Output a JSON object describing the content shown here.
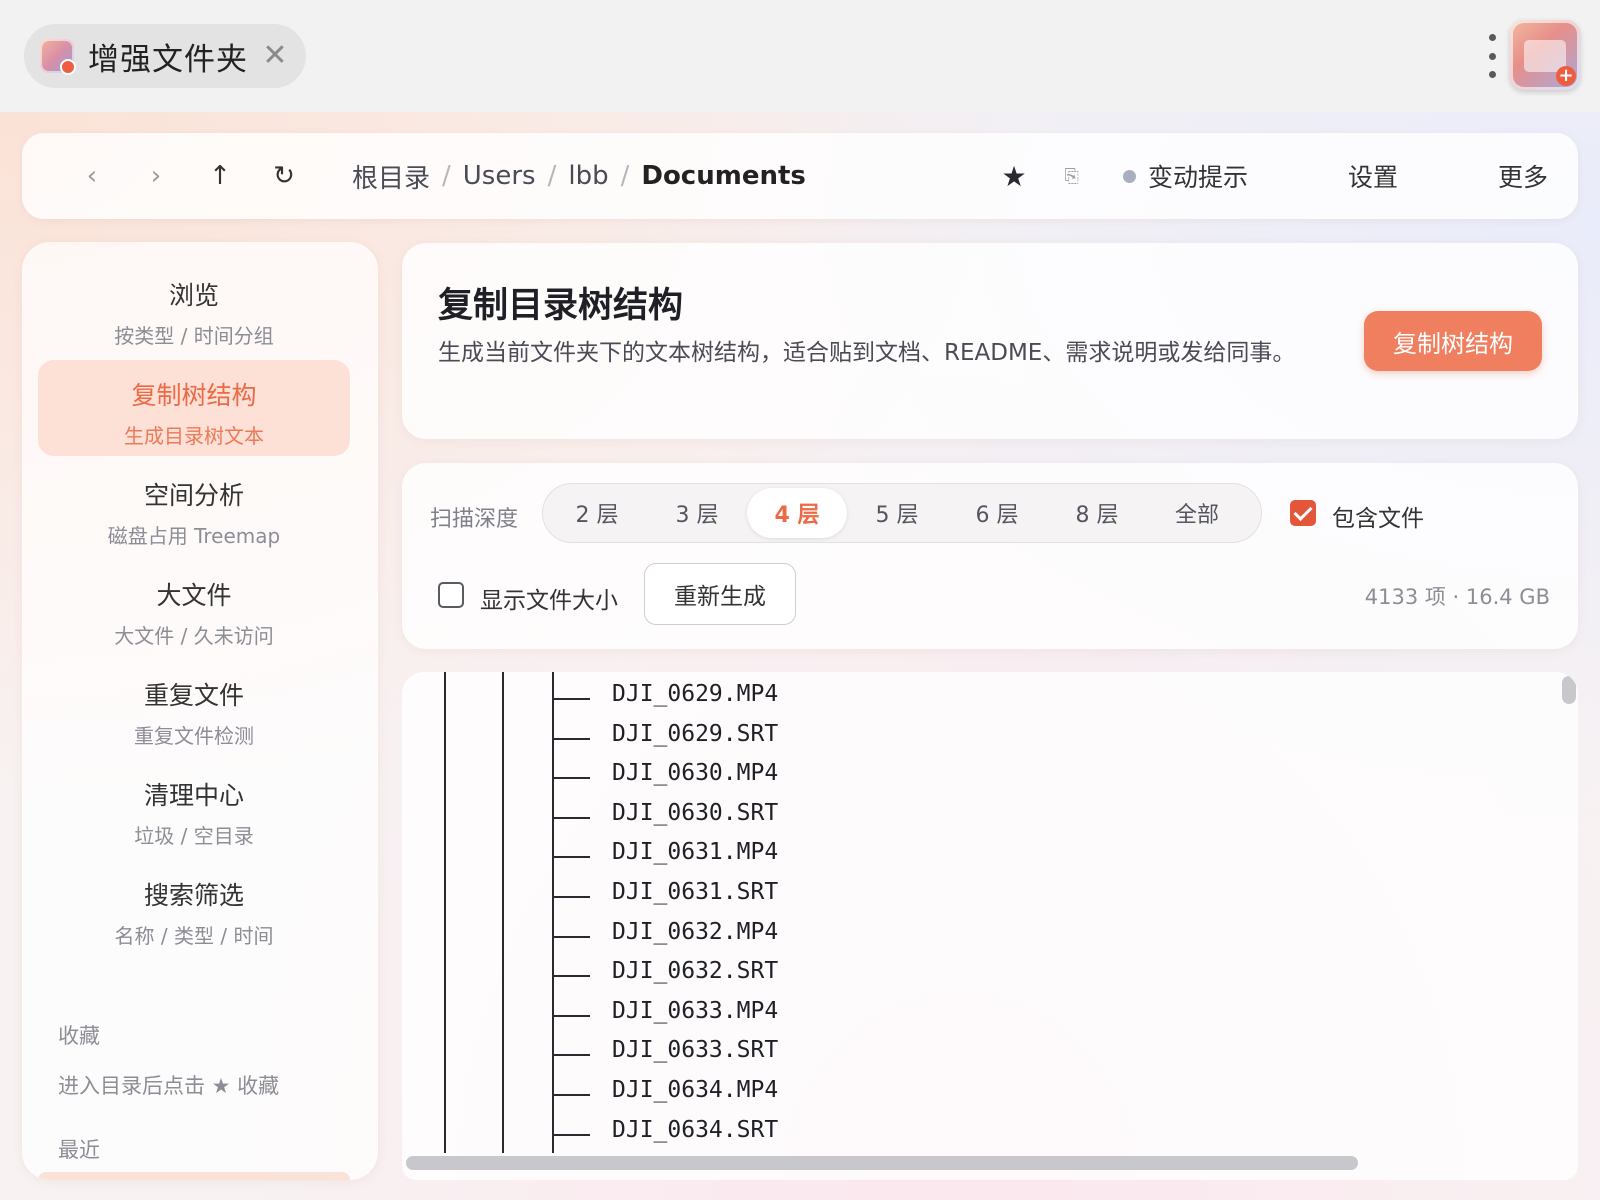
{
  "window": {
    "tab_title": "增强文件夹",
    "tab_icon": "app-folder-icon",
    "close_icon": "close-icon",
    "menu_icon": "kebab-menu-icon",
    "logo_icon": "app-logo-icon"
  },
  "nav": {
    "back": "‹",
    "forward": "›",
    "up": "↑",
    "refresh": "↻",
    "breadcrumbs": [
      "根目录",
      "Users",
      "lbb",
      "Documents"
    ],
    "separator": "/",
    "favorite": "★",
    "copy_path": "⎘",
    "change_notice": "变动提示",
    "settings": "设置",
    "more": "更多"
  },
  "sidebar": {
    "items": [
      {
        "title": "浏览",
        "subtitle": "按类型 / 时间分组",
        "active": false
      },
      {
        "title": "复制树结构",
        "subtitle": "生成目录树文本",
        "active": true
      },
      {
        "title": "空间分析",
        "subtitle": "磁盘占用 Treemap",
        "active": false
      },
      {
        "title": "大文件",
        "subtitle": "大文件 / 久未访问",
        "active": false
      },
      {
        "title": "重复文件",
        "subtitle": "重复文件检测",
        "active": false
      },
      {
        "title": "清理中心",
        "subtitle": "垃圾 / 空目录",
        "active": false
      },
      {
        "title": "搜索筛选",
        "subtitle": "名称 / 类型 / 时间",
        "active": false
      }
    ],
    "favorites_title": "收藏",
    "favorites_hint": "进入目录后点击 ★ 收藏",
    "recent_title": "最近"
  },
  "header": {
    "title": "复制目录树结构",
    "description": "生成当前文件夹下的文本树结构，适合贴到文档、README、需求说明或发给同事。",
    "copy_button": "复制树结构"
  },
  "options": {
    "depth_label": "扫描深度",
    "depths": [
      "2 层",
      "3 层",
      "4 层",
      "5 层",
      "6 层",
      "8 层",
      "全部"
    ],
    "selected_depth": "4 层",
    "include_files_label": "包含文件",
    "include_files": true,
    "show_size_label": "显示文件大小",
    "show_size": false,
    "regenerate_button": "重新生成",
    "stats": "4133 项 · 16.4 GB"
  },
  "tree": {
    "lines": [
      "DJI_0629.MP4",
      "DJI_0629.SRT",
      "DJI_0630.MP4",
      "DJI_0630.SRT",
      "DJI_0631.MP4",
      "DJI_0631.SRT",
      "DJI_0632.MP4",
      "DJI_0632.SRT",
      "DJI_0633.MP4",
      "DJI_0633.SRT",
      "DJI_0634.MP4",
      "DJI_0634.SRT"
    ]
  },
  "colors": {
    "accent": "#f07f5f",
    "active_text": "#ec6a45",
    "checkbox": "#e3563a"
  }
}
